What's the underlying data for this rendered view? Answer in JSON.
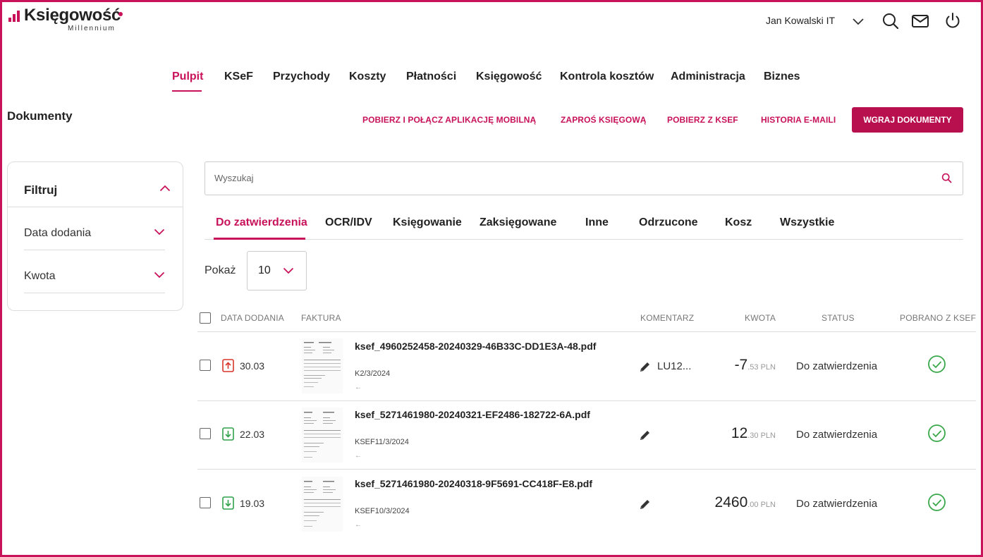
{
  "brand": {
    "name": "Księgowość",
    "subtitle": "Millennium",
    "accent": "#c8125a"
  },
  "header": {
    "user_name": "Jan Kowalski IT",
    "icons": [
      "chevron-down-icon",
      "search-icon",
      "mail-icon",
      "power-icon"
    ]
  },
  "nav": {
    "items": [
      {
        "label": "Pulpit",
        "active": true
      },
      {
        "label": "KSeF"
      },
      {
        "label": "Przychody"
      },
      {
        "label": "Koszty"
      },
      {
        "label": "Płatności"
      },
      {
        "label": "Księgowość"
      },
      {
        "label": "Kontrola kosztów"
      },
      {
        "label": "Administracja"
      },
      {
        "label": "Biznes"
      }
    ]
  },
  "page": {
    "title": "Dokumenty",
    "actions": [
      "POBIERZ I POŁĄCZ APLIKACJĘ MOBILNĄ",
      "ZAPROŚ KSIĘGOWĄ",
      "POBIERZ Z KSEF",
      "HISTORIA E-MAILI"
    ],
    "upload_label": "WGRAJ DOKUMENTY"
  },
  "filter": {
    "title": "Filtruj",
    "items": [
      {
        "label": "Data dodania"
      },
      {
        "label": "Kwota"
      }
    ]
  },
  "search": {
    "placeholder": "Wyszukaj",
    "value": ""
  },
  "tabs": [
    {
      "label": "Do zatwierdzenia",
      "active": true
    },
    {
      "label": "OCR/IDV"
    },
    {
      "label": "Księgowanie"
    },
    {
      "label": "Zaksięgowane"
    },
    {
      "label": "Inne"
    },
    {
      "label": "Odrzucone"
    },
    {
      "label": "Kosz"
    },
    {
      "label": "Wszystkie"
    }
  ],
  "pager": {
    "label": "Pokaż",
    "page_size": "10"
  },
  "table": {
    "columns": [
      "DATA DODANIA",
      "FAKTURA",
      "KOMENTARZ",
      "KWOTA",
      "STATUS",
      "POBRANO Z KSEF"
    ],
    "rows": [
      {
        "date": "30.03",
        "direction": "upload",
        "file": "ksef_4960252458-20240329-46B33C-DD1E3A-48.pdf",
        "number": "K2/3/2024",
        "arrow": "←",
        "comment": "LU12...",
        "amount_int": "-7",
        "amount_dec": ".53 PLN",
        "status": "Do zatwierdzenia",
        "ksef": true
      },
      {
        "date": "22.03",
        "direction": "download",
        "file": "ksef_5271461980-20240321-EF2486-182722-6A.pdf",
        "number": "KSEF11/3/2024",
        "arrow": "←",
        "comment": "",
        "amount_int": "12",
        "amount_dec": ".30 PLN",
        "status": "Do zatwierdzenia",
        "ksef": true
      },
      {
        "date": "19.03",
        "direction": "download",
        "file": "ksef_5271461980-20240318-9F5691-CC418F-E8.pdf",
        "number": "KSEF10/3/2024",
        "arrow": "←",
        "comment": "",
        "amount_int": "2460",
        "amount_dec": ".00 PLN",
        "status": "Do zatwierdzenia",
        "ksef": true
      }
    ]
  }
}
